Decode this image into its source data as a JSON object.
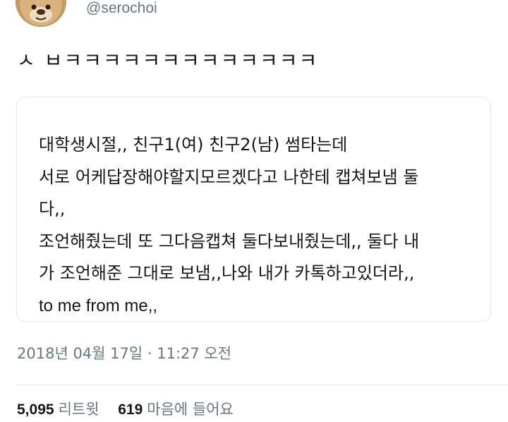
{
  "author": {
    "handle": "@serochoi",
    "avatar_icon": "teddy-bear-avatar"
  },
  "tweet": {
    "text": "ㅅ ㅂㅋㅋㅋㅋㅋㅋㅋㅋㅋㅋㅋㅋㅋ",
    "quoted_card": {
      "lines": [
        "대학생시절,, 친구1(여) 친구2(남) 썸타는데",
        "서로 어케답장해야할지모르겠다고 나한테 캡쳐보냄 둘",
        "다,,",
        "조언해줬는데 또 그다음캡쳐 둘다보내줬는데,, 둘다 내",
        "가 조언해준 그대로 보냄,,나와 내가 카톡하고있더라,,",
        "to me from me,,"
      ]
    },
    "timestamp": "2018년 04월 17일 · 11:27 오전"
  },
  "stats": {
    "retweets": {
      "count": "5,095",
      "label": "리트윗"
    },
    "likes": {
      "count": "619",
      "label": "마음에 들어요"
    }
  },
  "colors": {
    "text_primary": "#14171a",
    "text_secondary": "#657786",
    "border": "#e1e8ed"
  }
}
